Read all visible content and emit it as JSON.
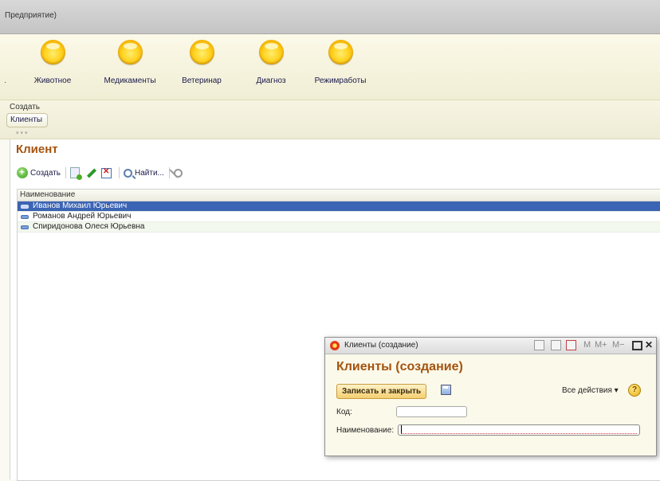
{
  "window": {
    "title": "Предприятие)"
  },
  "sections": [
    {
      "label": "Животное"
    },
    {
      "label": "Медикаменты"
    },
    {
      "label": "Ветеринар"
    },
    {
      "label": "Диагноз"
    },
    {
      "label": "Режимработы"
    }
  ],
  "nav": {
    "create_label": "Создать",
    "active_tab": "Клиенты"
  },
  "form": {
    "title": "Клиент",
    "toolbar": {
      "create": "Создать",
      "find": "Найти..."
    },
    "table": {
      "column": "Наименование",
      "rows": [
        {
          "name": "Иванов Михаил Юрьевич"
        },
        {
          "name": "Романов Андрей Юрьевич"
        },
        {
          "name": "Спиридонова Олеся Юрьевна"
        }
      ]
    }
  },
  "dialog": {
    "window_title": "Клиенты (создание)",
    "title": "Клиенты (создание)",
    "save_close": "Записать и закрыть",
    "all_actions": "Все действия ▾",
    "help": "?",
    "fields": {
      "code_label": "Код:",
      "code_value": "",
      "name_label": "Наименование:",
      "name_value": ""
    },
    "calc": {
      "m": "M",
      "mplus": "M+",
      "mminus": "M−"
    }
  }
}
